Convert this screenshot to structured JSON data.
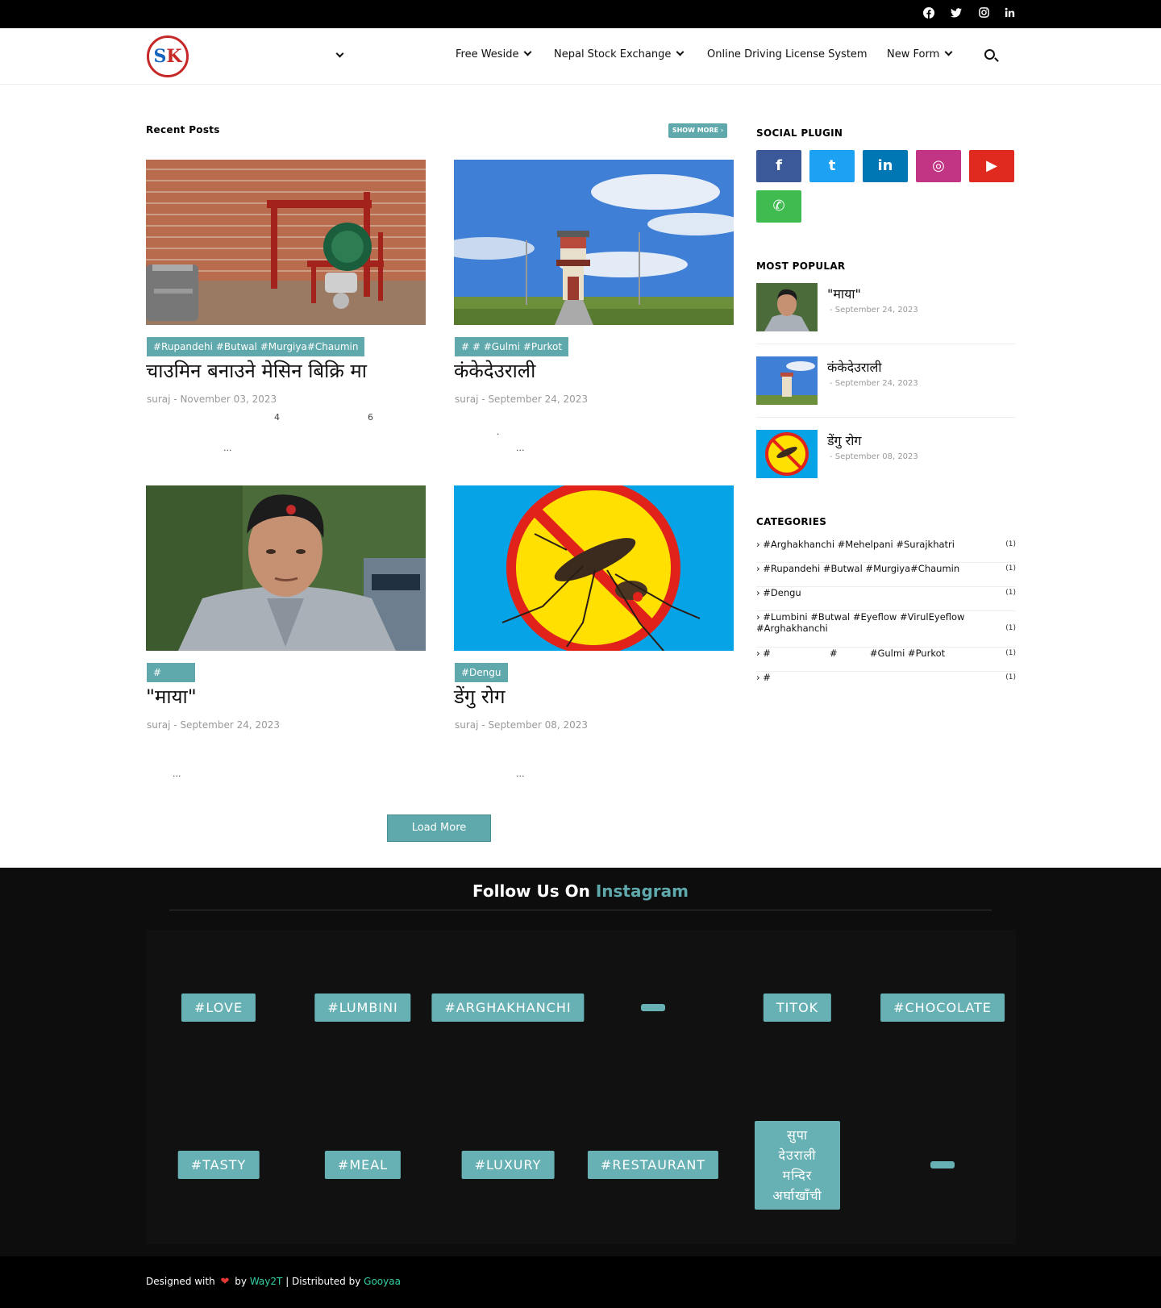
{
  "topbar": {
    "tagline": "",
    "social_icons": [
      "facebook-icon",
      "twitter-icon",
      "instagram-icon",
      "linkedin-icon"
    ]
  },
  "header": {
    "logo_text_s": "S",
    "logo_text_k": "K",
    "nav": [
      {
        "label": "Free Weside",
        "dropdown": true
      },
      {
        "label": "Nepal Stock Exchange",
        "dropdown": true
      },
      {
        "label": "Online Driving License System",
        "dropdown": false
      },
      {
        "label": "New Form",
        "dropdown": true
      }
    ]
  },
  "recent": {
    "heading": "Recent Posts",
    "show_more": "SHOW MORE ›",
    "posts": [
      {
        "label": "#Rupandehi #Butwal #Murgiya#Chaumin",
        "title": "चाउमिन बनाउने मेसिन बिक्रि मा",
        "meta": "suraj - November 03, 2023",
        "snippet_a": "4",
        "snippet_b": "6",
        "snippet_end": "..."
      },
      {
        "label": "#                    #           #Gulmi #Purkot",
        "title": "कंकेदेउराली",
        "meta": "suraj - September 24, 2023",
        "snippet_dot": ".",
        "snippet_end": "..."
      },
      {
        "label": "#",
        "title": "\"माया\"",
        "meta": "suraj - September 24, 2023",
        "snippet_end": "..."
      },
      {
        "label": "#Dengu",
        "title": "डेंगु रोग",
        "meta": "suraj - September 08, 2023",
        "snippet_end": "..."
      }
    ],
    "load_more": "Load More"
  },
  "sidebar": {
    "social_heading": "SOCIAL PLUGIN",
    "social": [
      {
        "icon": "facebook-icon",
        "glyph": "f",
        "color": "#3b5998"
      },
      {
        "icon": "twitter-icon",
        "glyph": "t",
        "color": "#1da1f2"
      },
      {
        "icon": "linkedin-icon",
        "glyph": "in",
        "color": "#0077b5"
      },
      {
        "icon": "instagram-icon",
        "glyph": "◎",
        "color": "#c13584"
      },
      {
        "icon": "youtube-icon",
        "glyph": "▶",
        "color": "#e02a20"
      },
      {
        "icon": "whatsapp-icon",
        "glyph": "✆",
        "color": "#3fbb50"
      }
    ],
    "popular_heading": "MOST POPULAR",
    "popular": [
      {
        "title": "\"माया\"",
        "date": "- September 24, 2023"
      },
      {
        "title": "कंकेदेउराली",
        "date": "- September 24, 2023"
      },
      {
        "title": "डेंगु रोग",
        "date": "- September 08, 2023"
      }
    ],
    "categories_heading": "CATEGORIES",
    "categories": [
      {
        "name": "› #Arghakhanchi #Mehelpani #Surajkhatri",
        "count": "(1)"
      },
      {
        "name": "› #Rupandehi #Butwal #Murgiya#Chaumin",
        "count": "(1)"
      },
      {
        "name": "› #Dengu",
        "count": "(1)"
      },
      {
        "name": "› #Lumbini #Butwal #Eyeflow #VirulEyeflow #Arghakhanchi",
        "count": "(1)"
      },
      {
        "name": "› #                    #           #Gulmi #Purkot",
        "count": "(1)"
      },
      {
        "name": "› #",
        "count": "(1)"
      }
    ]
  },
  "instagram": {
    "title_a": "Follow Us On",
    "title_b": "Instagram",
    "tags": [
      "#LOVE",
      "#LUMBINI",
      "#ARGHAKHANCHI",
      "",
      "TITOK",
      "#CHOCOLATE",
      "#TASTY",
      "#MEAL",
      "#LUXURY",
      "#RESTAURANT",
      "सुपा देउराली मन्दिर अर्घाखाँची",
      ""
    ]
  },
  "footer": {
    "designed": "Designed with",
    "by": "by",
    "way2t": "Way2T",
    "distributed": "| Distributed by",
    "gooyaa": "Gooyaa"
  }
}
